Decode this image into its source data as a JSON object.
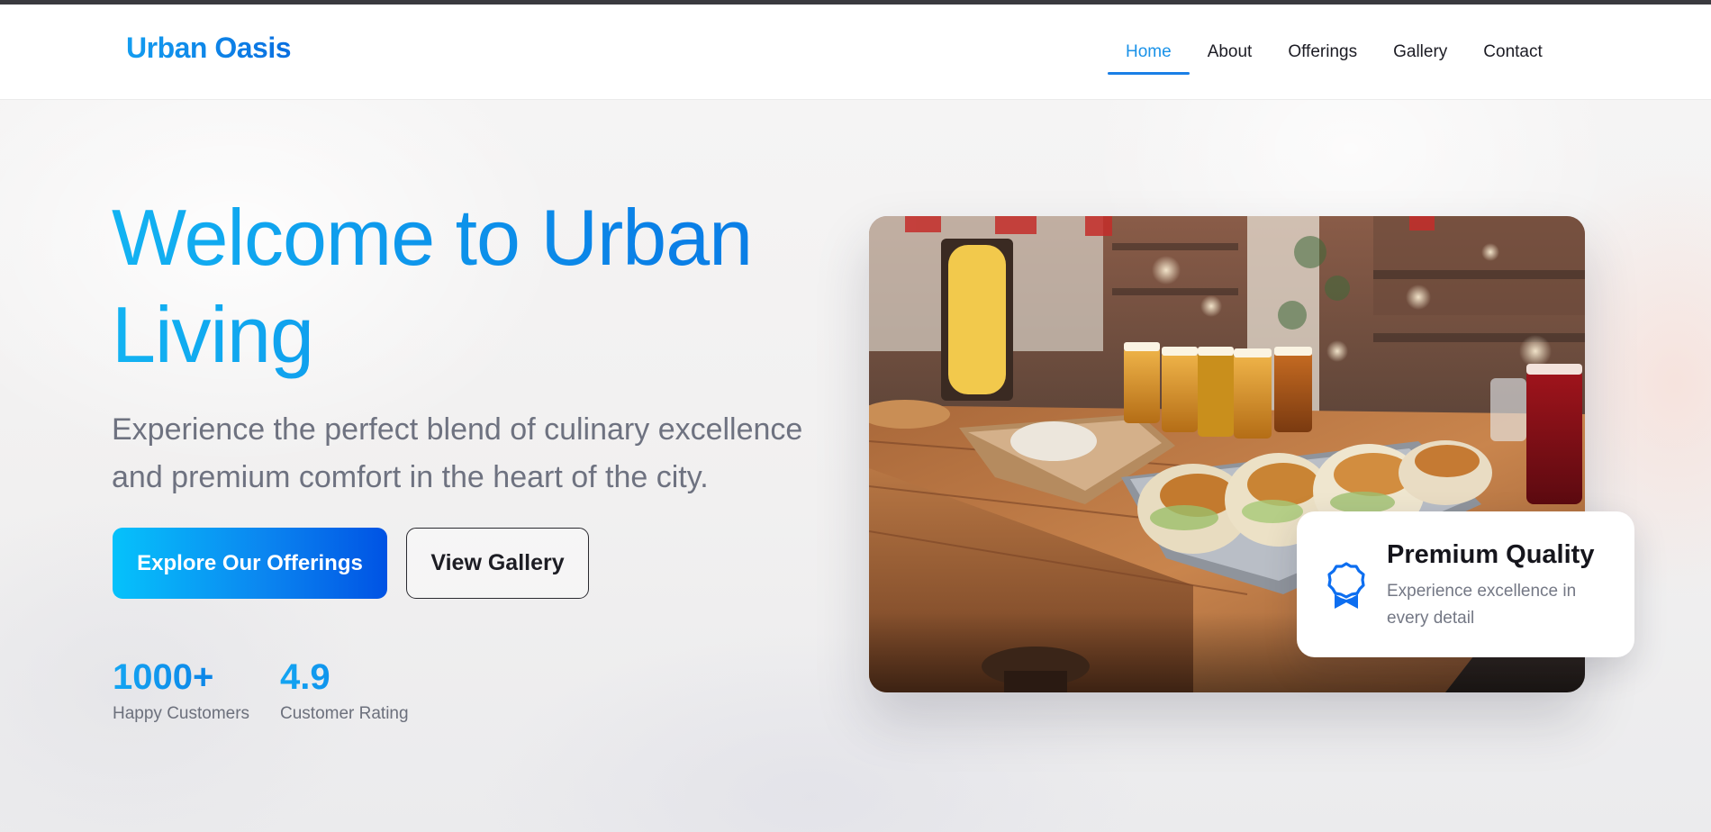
{
  "header": {
    "brand": "Urban Oasis",
    "nav": [
      {
        "label": "Home",
        "active": true
      },
      {
        "label": "About",
        "active": false
      },
      {
        "label": "Offerings",
        "active": false
      },
      {
        "label": "Gallery",
        "active": false
      },
      {
        "label": "Contact",
        "active": false
      }
    ]
  },
  "hero": {
    "title_line1": "Welcome to Urban",
    "title_line2": "Living",
    "subtitle": "Experience the perfect blend of culinary excellence and premium comfort in the heart of the city.",
    "primary_button": "Explore Our Offerings",
    "secondary_button": "View Gallery",
    "stats": [
      {
        "value": "1000+",
        "label": "Happy Customers"
      },
      {
        "value": "4.9",
        "label": "Customer Rating"
      }
    ]
  },
  "feature_card": {
    "icon": "award-icon",
    "title": "Premium Quality",
    "description": "Experience excellence in every detail"
  },
  "colors": {
    "accent": "#1a92e8",
    "accent_dark": "#0053e4",
    "accent_light": "#06c2fb",
    "text_dark": "#1c1c24",
    "text_muted": "#6e7280"
  }
}
